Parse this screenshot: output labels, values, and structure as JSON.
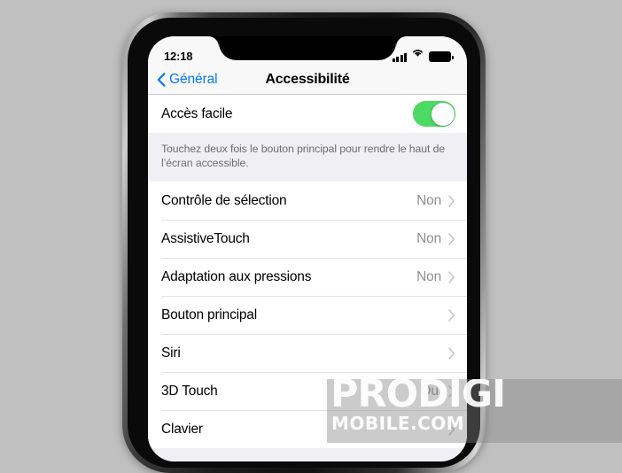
{
  "status_bar": {
    "time": "12:18",
    "icons": [
      "cellular-signal-icon",
      "wifi-icon",
      "battery-icon"
    ]
  },
  "nav_bar": {
    "back_label": "Général",
    "back_icon": "chevron-left-icon",
    "title": "Accessibilité"
  },
  "sections": [
    {
      "rows": [
        {
          "label": "Accès facile",
          "control": "switch",
          "switch_on": true
        }
      ],
      "footnote": "Touchez deux fois le bouton principal pour rendre le haut de l’écran accessible."
    },
    {
      "rows": [
        {
          "label": "Contrôle de sélection",
          "value": "Non",
          "control": "disclosure"
        },
        {
          "label": "AssistiveTouch",
          "value": "Non",
          "control": "disclosure"
        },
        {
          "label": "Adaptation aux pressions",
          "value": "Non",
          "control": "disclosure"
        },
        {
          "label": "Bouton principal",
          "value": "",
          "control": "disclosure"
        },
        {
          "label": "Siri",
          "value": "",
          "control": "disclosure"
        },
        {
          "label": "3D Touch",
          "value": "Oui",
          "control": "disclosure"
        },
        {
          "label": "Clavier",
          "value": "",
          "control": "disclosure"
        }
      ]
    }
  ],
  "watermark": {
    "main": "PRODIGI",
    "sub": "MOBILE.COM"
  },
  "colors": {
    "accent_blue": "#007aff",
    "switch_green": "#4cd964",
    "value_gray": "#8e8e93",
    "page_background": "#c0c0c0"
  }
}
